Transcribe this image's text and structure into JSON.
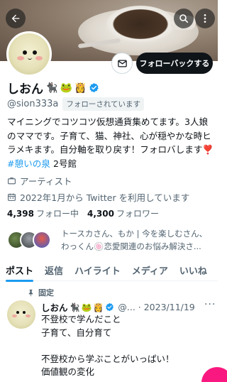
{
  "profile": {
    "display_name": "しおん",
    "name_emojis": [
      "🐈‍⬛",
      "🐸",
      "👸"
    ],
    "handle": "@sion333a",
    "follows_you": "フォローされています",
    "bio_text": "マイニングでコツコツ仮想通貨集めてます。3人娘のママです。子育て、猫、神社、心が穏やかな時ヒラメキます。自分軸を取り戻す！フォロバします❣️",
    "bio_hashtag": "#憩いの泉",
    "bio_tail": " 2号館",
    "category": "アーティスト",
    "joined": "2022年1月から Twitter を利用しています",
    "following_count": "4,398",
    "following_label": "フォロー中",
    "followers_count": "4,300",
    "followers_label": "フォロワー",
    "known_followers_text": "トースカさん、もか | 今を楽しむさん、わっくん🍥恋愛関連のお悩み解決さ..."
  },
  "actions": {
    "follow_back_label": "フォローバックする"
  },
  "tabs": [
    "ポスト",
    "返信",
    "ハイライト",
    "メディア",
    "いいね"
  ],
  "active_tab": "ポスト",
  "pinned_post": {
    "pinned_label": "固定",
    "author_name": "しおん",
    "author_emojis": [
      "🐈‍⬛",
      "🐸",
      "👸"
    ],
    "meta": "@... · 2023/11/19",
    "more": "···",
    "body": "不登校で学んだこと\n子育て、自分育て\n\n不登校から学ぶことがいっぱい！\n価値観の変化"
  },
  "icons": {
    "back": "arrow-left-icon",
    "search": "search-icon",
    "more": "more-vertical-icon",
    "mail": "mail-icon",
    "verified": "verified-badge-icon",
    "category": "briefcase-icon",
    "joined": "calendar-icon",
    "pin": "pin-icon"
  },
  "colors": {
    "accent": "#1d9bf0",
    "follow_button_bg": "#0f1419",
    "fab": "#f91880"
  }
}
